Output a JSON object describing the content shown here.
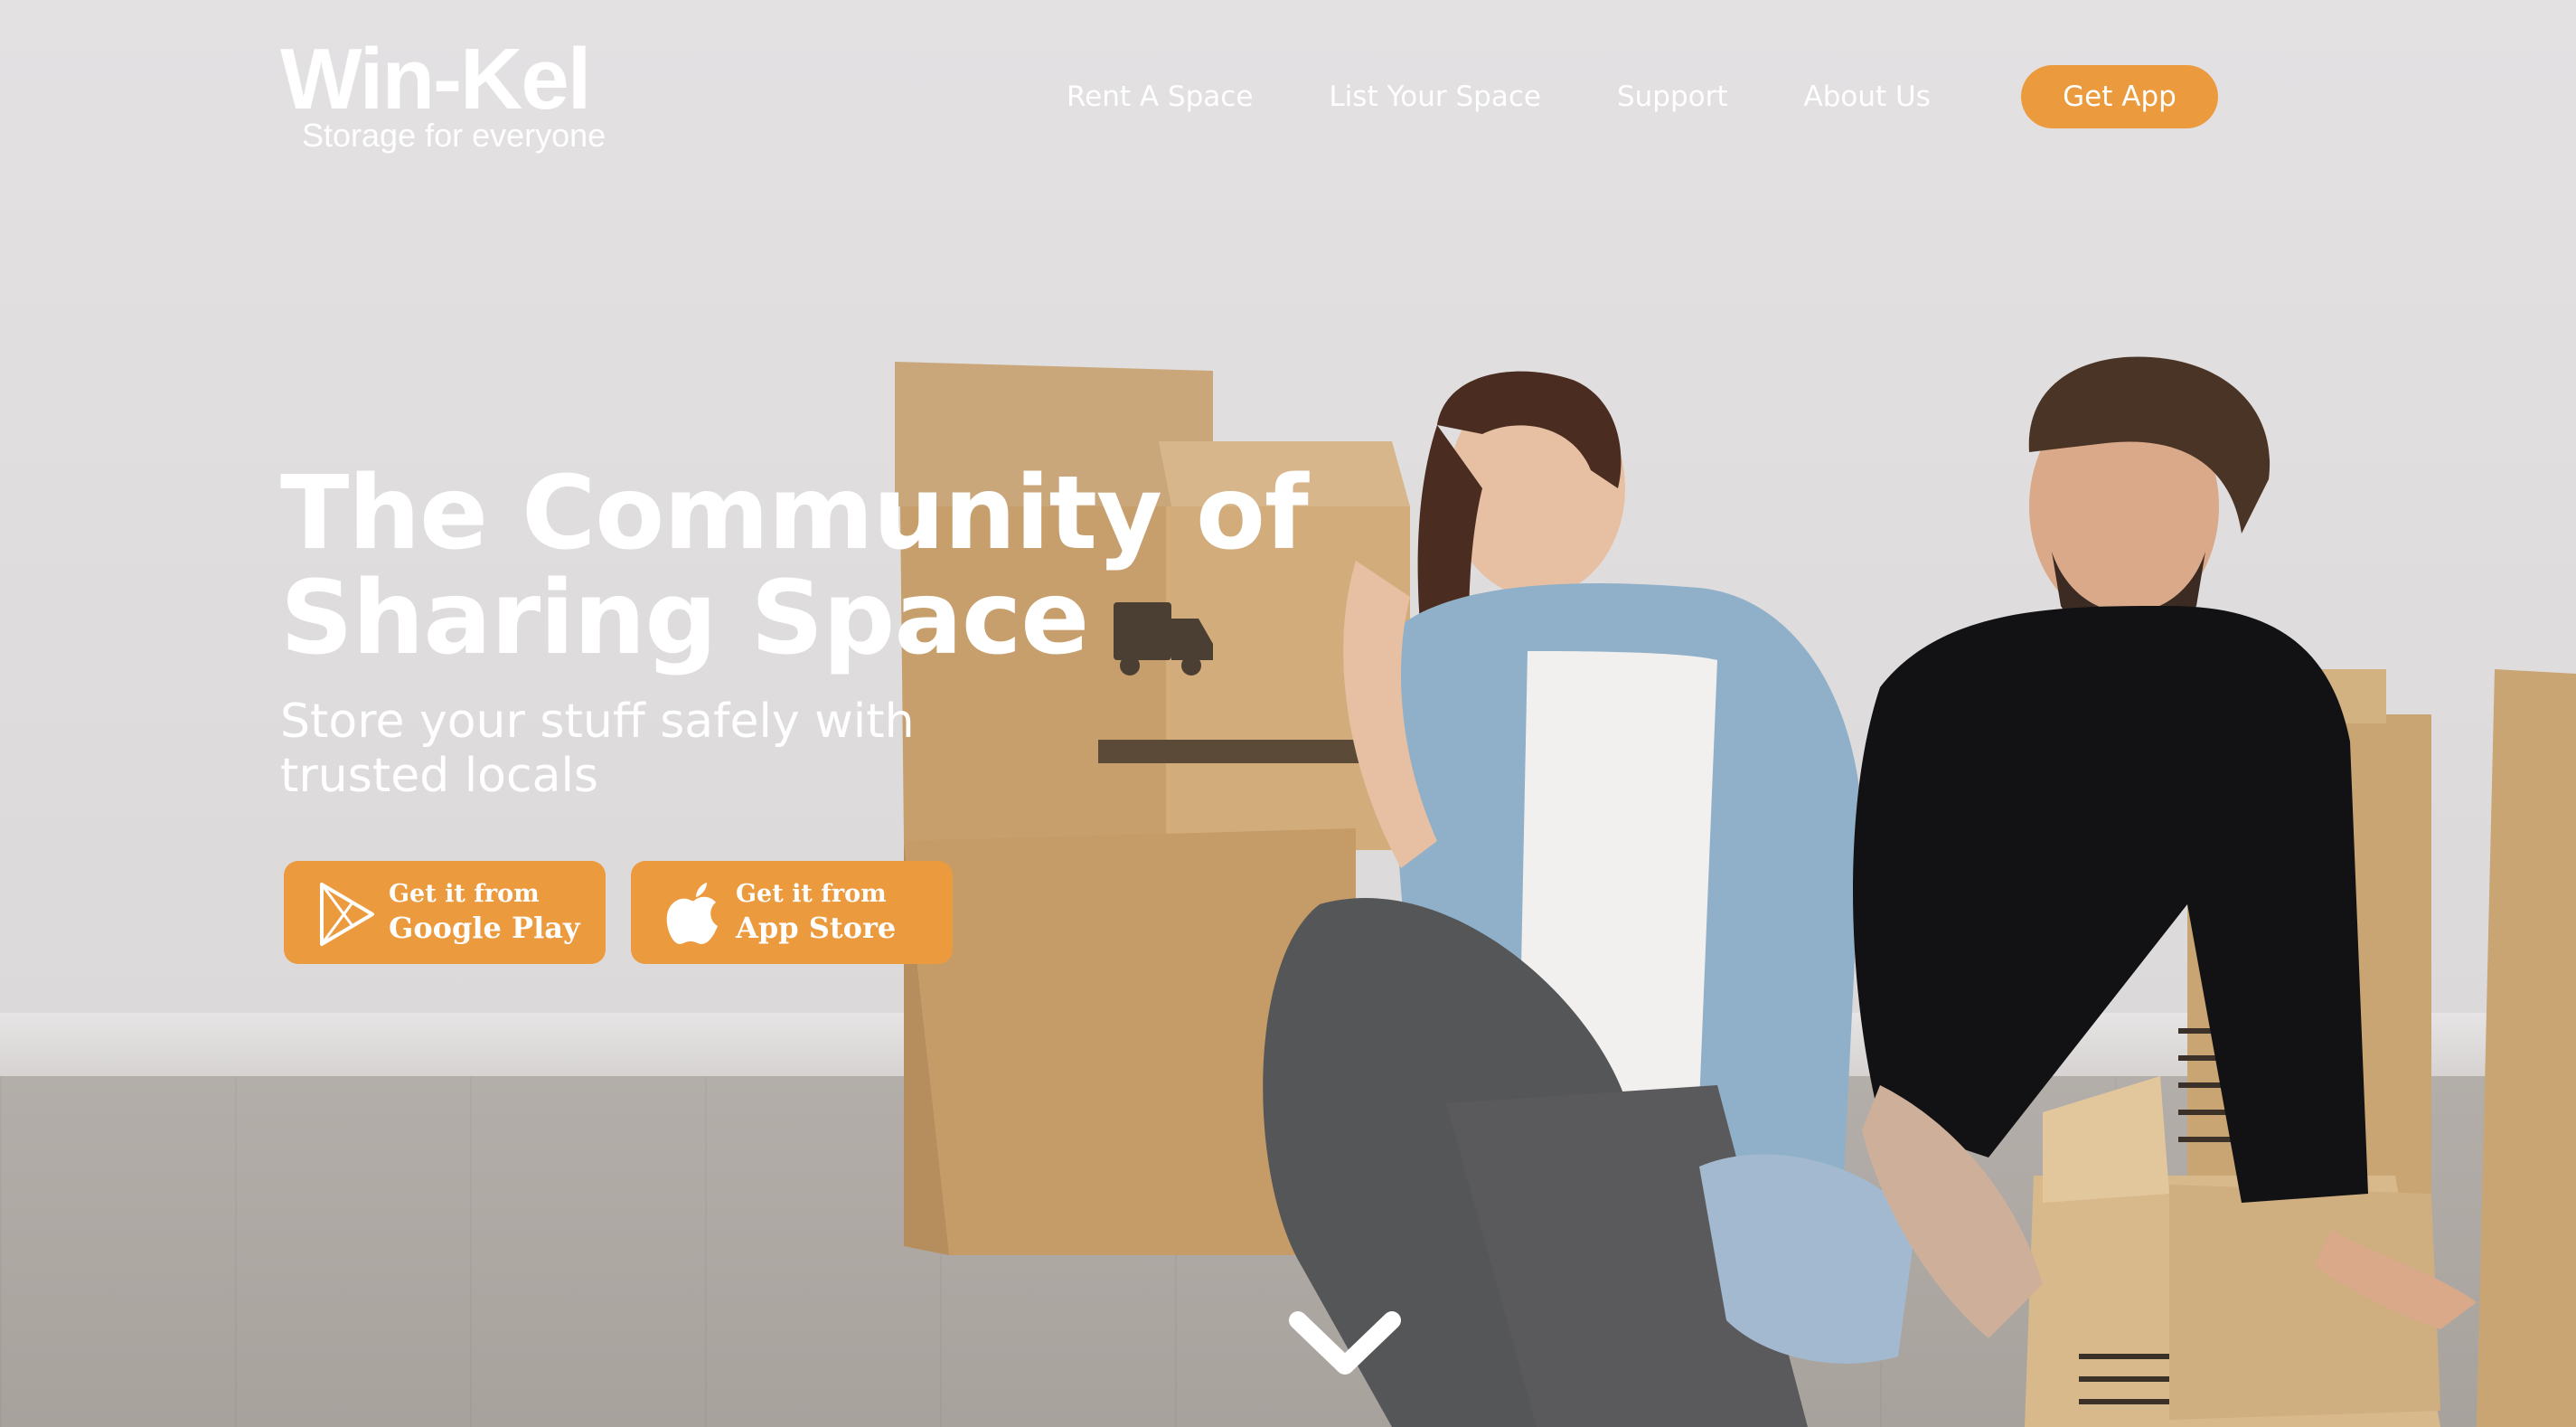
{
  "brand": {
    "name": "Win-Kel",
    "tagline": "Storage for everyone"
  },
  "nav": {
    "items": [
      {
        "label": "Rent A Space"
      },
      {
        "label": "List Your Space"
      },
      {
        "label": "Support"
      },
      {
        "label": "About Us"
      }
    ],
    "cta_label": "Get App"
  },
  "hero": {
    "headline_line1": "The Community of",
    "headline_line2": "Sharing Space",
    "subline_line1": "Store your stuff safely with",
    "subline_line2": "trusted locals",
    "buttons": [
      {
        "small": "Get it from",
        "big": "Google Play",
        "icon": "google-play-icon"
      },
      {
        "small": "Get it from",
        "big": "App Store",
        "icon": "apple-icon"
      }
    ],
    "scroll_icon": "chevron-down-icon"
  },
  "colors": {
    "accent": "#ec9a3e",
    "text": "#ffffff",
    "wall": "#dedbdc"
  }
}
